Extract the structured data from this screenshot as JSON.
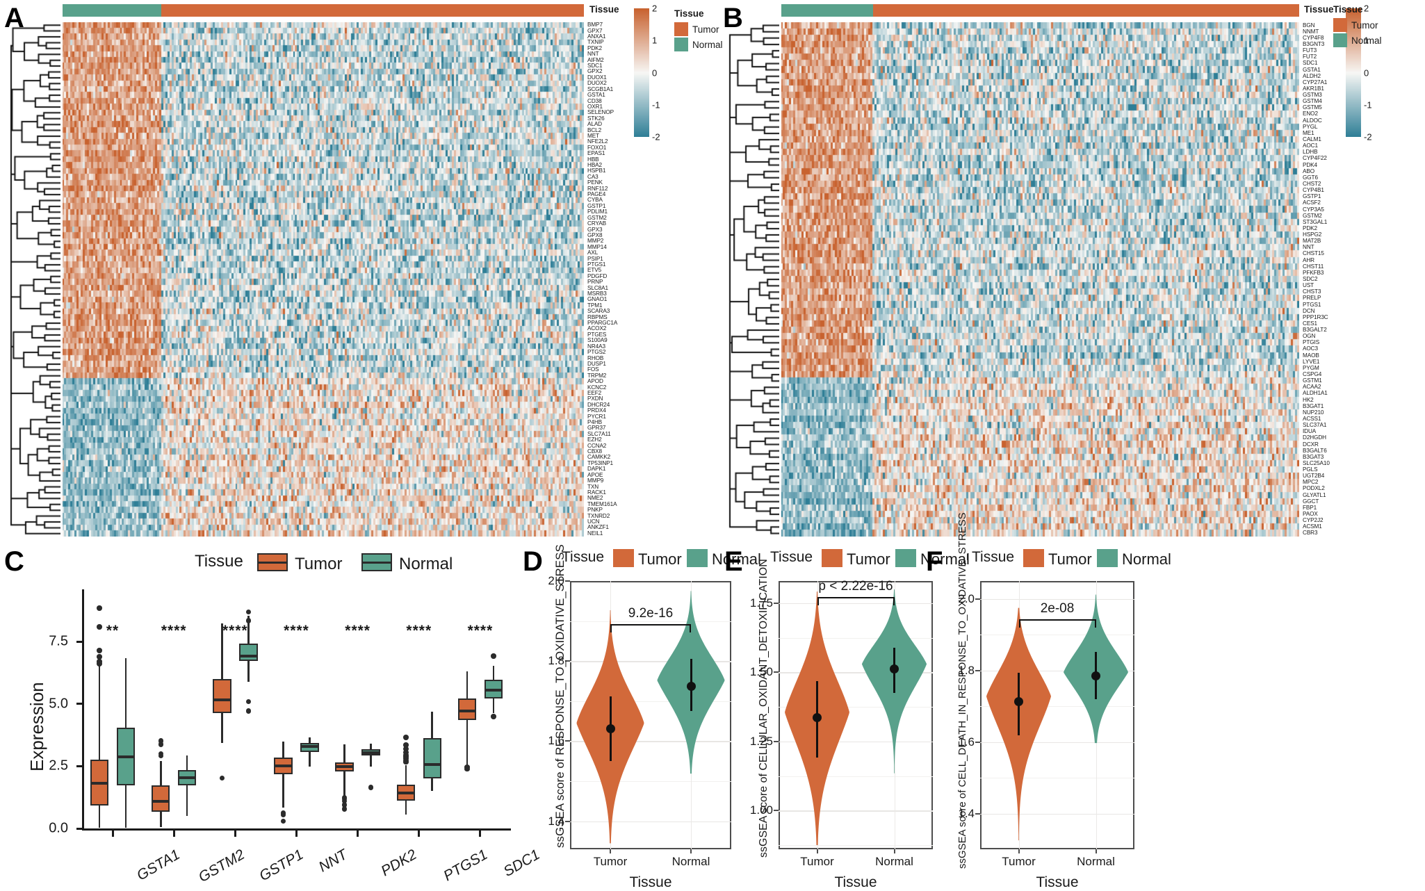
{
  "figure": {
    "panels": [
      "A",
      "B",
      "C",
      "D",
      "E",
      "F"
    ],
    "colors": {
      "tumor": "#d2693a",
      "normal": "#59a18b",
      "heat_high": "#c8622f",
      "heat_mid": "#f7f7f5",
      "heat_low": "#2e7e96",
      "outline": "#2b2b2b"
    }
  },
  "panelA": {
    "letter": "A",
    "annotation_title": "Tissue",
    "colorbar": {
      "ticks": [
        "2",
        "1",
        "0",
        "-1",
        "-2"
      ],
      "max": 2,
      "min": -2
    },
    "legend": {
      "title": "Tissue",
      "items": [
        {
          "label": "Tumor",
          "color": "#d2693a"
        },
        {
          "label": "Normal",
          "color": "#59a18b"
        }
      ]
    },
    "genes": [
      "BMP7",
      "GPX7",
      "ANXA1",
      "TXNIP",
      "PDK2",
      "NNT",
      "AIFM2",
      "SDC1",
      "GPX2",
      "DUOX1",
      "DUOX2",
      "SCGB1A1",
      "GSTA1",
      "CD38",
      "OXR1",
      "SELENOP",
      "STK26",
      "ALAD",
      "BCL2",
      "MET",
      "NFE2L2",
      "FOXO1",
      "EPAS1",
      "HBB",
      "HBA2",
      "HSPB1",
      "CA3",
      "PENK",
      "RNF112",
      "PAGE4",
      "CYBA",
      "GSTP1",
      "PDLIM1",
      "GSTM2",
      "CRYAB",
      "GPX3",
      "GPX8",
      "MMP2",
      "MMP14",
      "AXL",
      "PSIP1",
      "PTGS1",
      "ETV5",
      "PDGFD",
      "PRNP",
      "SLC8A1",
      "MSRB3",
      "GNAO1",
      "TPM1",
      "SCARA3",
      "RBPMS",
      "PPARGC1A",
      "ACOX2",
      "PTGES",
      "S100A9",
      "NR4A3",
      "PTGS2",
      "RHOB",
      "DUSP1",
      "FOS",
      "TRPM2",
      "APOD",
      "KCNC2",
      "EEF2",
      "PXDN",
      "DHCR24",
      "PRDX4",
      "PYCR1",
      "P4HB",
      "GPR37",
      "SLC7A11",
      "EZH2",
      "CCNA2",
      "CBX8",
      "CAMKK2",
      "TP53INP1",
      "DAPK1",
      "APOE",
      "MMP9",
      "TXN",
      "RACK1",
      "NME2",
      "TMEM161A",
      "PNKP",
      "TXNRD2",
      "UCN",
      "ANKZF1",
      "NEIL1"
    ]
  },
  "panelB": {
    "letter": "B",
    "annotation_title": "Tissue",
    "colorbar": {
      "ticks": [
        "2",
        "1",
        "0",
        "-1",
        "-2"
      ],
      "max": 2,
      "min": -2
    },
    "legend": {
      "title": "Tissue",
      "items": [
        {
          "label": "Tumor",
          "color": "#d2693a"
        },
        {
          "label": "Normal",
          "color": "#59a18b"
        }
      ]
    },
    "genes": [
      "BGN",
      "NNMT",
      "CYP4F8",
      "B3GNT3",
      "FUT3",
      "FUT2",
      "SDC1",
      "GSTA1",
      "ALDH2",
      "CYP27A1",
      "AKR1B1",
      "GSTM3",
      "GSTM4",
      "GSTM5",
      "ENO2",
      "ALDOC",
      "PYGL",
      "ME1",
      "CALM1",
      "AOC1",
      "LDHB",
      "CYP4F22",
      "PDK4",
      "ABO",
      "GGT6",
      "CHST2",
      "CYP4B1",
      "GSTP1",
      "ACSF2",
      "CYP3A5",
      "GSTM2",
      "ST3GAL1",
      "PDK2",
      "HSPG2",
      "MAT2B",
      "NNT",
      "CHST15",
      "AHR",
      "CHST11",
      "PFKFB3",
      "SDC2",
      "UST",
      "CHST3",
      "PRELP",
      "PTGS1",
      "DCN",
      "PPP1R3C",
      "CES1",
      "B3GALT2",
      "OGN",
      "PTGIS",
      "AOC3",
      "MAOB",
      "LYVE1",
      "PYGM",
      "CSPG4",
      "GSTM1",
      "ACAA2",
      "ALDH1A1",
      "HK2",
      "B3GAT1",
      "NUP210",
      "ACSS1",
      "SLC37A1",
      "IDUA",
      "D2HGDH",
      "DCXR",
      "B3GALT6",
      "B3GAT3",
      "SLC25A10",
      "PGLS",
      "UGT2B4",
      "MPC2",
      "PODXL2",
      "GLYATL1",
      "GGCT",
      "FBP1",
      "PAOX",
      "CYP2J2",
      "ACSM1",
      "CBR3"
    ]
  },
  "panelC": {
    "letter": "C",
    "legend": {
      "title": "Tissue",
      "items": [
        {
          "label": "Tumor",
          "color": "#d2693a"
        },
        {
          "label": "Normal",
          "color": "#59a18b"
        }
      ]
    },
    "chart_data": {
      "type": "box",
      "title": "",
      "xlabel": "",
      "ylabel": "Expression",
      "ylim": [
        0.0,
        9.6
      ],
      "yticks": [
        "0.0",
        "2.5",
        "5.0",
        "7.5"
      ],
      "ytickvals": [
        0.0,
        2.5,
        5.0,
        7.5
      ],
      "categories": [
        "GSTA1",
        "GSTM2",
        "GSTP1",
        "NNT",
        "PDK2",
        "PTGS1",
        "SDC1"
      ],
      "significance": [
        "**",
        "****",
        "****",
        "****",
        "****",
        "****",
        "****"
      ],
      "legend_position": "top",
      "series": [
        {
          "name": "Tumor",
          "color": "#d2693a",
          "boxes": [
            {
              "category": "GSTA1",
              "min": 0.02,
              "q1": 0.93,
              "median": 1.82,
              "q3": 2.77,
              "max": 6.55,
              "outliers": [
                8.85,
                8.1,
                7.15,
                6.9,
                6.7,
                6.62
              ]
            },
            {
              "category": "GSTM2",
              "min": 0.05,
              "q1": 0.68,
              "median": 1.1,
              "q3": 1.72,
              "max": 2.72,
              "outliers": [
                3.52,
                3.38,
                3.0,
                2.92
              ]
            },
            {
              "category": "GSTP1",
              "min": 3.42,
              "q1": 4.62,
              "median": 5.16,
              "q3": 6.0,
              "max": 8.22,
              "outliers": [
                2.02
              ]
            },
            {
              "category": "NNT",
              "min": 0.85,
              "q1": 2.18,
              "median": 2.52,
              "q3": 2.84,
              "max": 3.5,
              "outliers": [
                0.62,
                0.55,
                0.3
              ]
            },
            {
              "category": "PDK2",
              "min": 1.28,
              "q1": 2.3,
              "median": 2.48,
              "q3": 2.66,
              "max": 3.38,
              "outliers": [
                1.24,
                1.18,
                1.1,
                0.95,
                0.78
              ]
            },
            {
              "category": "PTGS1",
              "min": 0.55,
              "q1": 1.12,
              "median": 1.42,
              "q3": 1.75,
              "max": 2.55,
              "outliers": [
                3.65,
                3.35,
                3.2,
                3.05,
                2.95,
                2.88,
                2.8,
                2.72,
                2.66
              ]
            },
            {
              "category": "SDC1",
              "min": 2.48,
              "q1": 4.35,
              "median": 4.73,
              "q3": 5.22,
              "max": 6.3,
              "outliers": [
                2.45,
                2.38
              ]
            }
          ]
        },
        {
          "name": "Normal",
          "color": "#59a18b",
          "boxes": [
            {
              "category": "GSTA1",
              "min": 0.02,
              "q1": 1.73,
              "median": 2.88,
              "q3": 4.05,
              "max": 6.85,
              "outliers": []
            },
            {
              "category": "GSTM2",
              "min": 0.5,
              "q1": 1.72,
              "median": 2.05,
              "q3": 2.35,
              "max": 2.92,
              "outliers": []
            },
            {
              "category": "GSTP1",
              "min": 5.9,
              "q1": 6.72,
              "median": 6.92,
              "q3": 7.42,
              "max": 8.55,
              "outliers": [
                8.7,
                8.35,
                5.1,
                4.72
              ]
            },
            {
              "category": "NNT",
              "min": 2.48,
              "q1": 3.08,
              "median": 3.28,
              "q3": 3.42,
              "max": 3.65,
              "outliers": []
            },
            {
              "category": "PDK2",
              "min": 2.48,
              "q1": 2.92,
              "median": 3.04,
              "q3": 3.18,
              "max": 3.4,
              "outliers": [
                1.65
              ]
            },
            {
              "category": "PTGS1",
              "min": 1.5,
              "q1": 2.02,
              "median": 2.58,
              "q3": 3.62,
              "max": 4.68,
              "outliers": []
            },
            {
              "category": "SDC1",
              "min": 4.62,
              "q1": 5.22,
              "median": 5.56,
              "q3": 5.98,
              "max": 6.52,
              "outliers": [
                6.92,
                4.5
              ]
            }
          ]
        }
      ]
    }
  },
  "panelD": {
    "letter": "D",
    "legend": {
      "title": "Tissue",
      "items": [
        {
          "label": "Tumor",
          "color": "#d2693a"
        },
        {
          "label": "Normal",
          "color": "#59a18b"
        }
      ]
    },
    "chart_data": {
      "type": "violin",
      "ylabel": "ssGSEA score of RESPONSE_TO_OXIDATIVE_STRESS",
      "xlabel": "Tissue",
      "ylim": [
        1.33,
        2.0
      ],
      "yticks": [
        "1.4",
        "1.6",
        "1.8",
        "2.0"
      ],
      "ytickvals": [
        1.4,
        1.6,
        1.8,
        2.0
      ],
      "categories": [
        "Tumor",
        "Normal"
      ],
      "annotation": "9.2e-16",
      "groups": [
        {
          "name": "Tumor",
          "color": "#d2693a",
          "mean": 1.631,
          "ci_low": 1.551,
          "ci_high": 1.712,
          "min": 1.345,
          "max": 1.927,
          "mode": 1.645
        },
        {
          "name": "Normal",
          "color": "#59a18b",
          "mean": 1.737,
          "ci_low": 1.675,
          "ci_high": 1.805,
          "min": 1.519,
          "max": 1.975,
          "mode": 1.752
        }
      ]
    }
  },
  "panelE": {
    "letter": "E",
    "legend": {
      "title": "Tissue",
      "items": [
        {
          "label": "Tumor",
          "color": "#d2693a"
        },
        {
          "label": "Normal",
          "color": "#59a18b"
        }
      ]
    },
    "chart_data": {
      "type": "violin",
      "ylabel": "ssGSEA score of CELLULAR_OXIDANT_DETOXIFICATION",
      "xlabel": "Tissue",
      "ylim": [
        0.86,
        1.83
      ],
      "yticks": [
        "1.00",
        "1.25",
        "1.50",
        "1.75"
      ],
      "ytickvals": [
        1.0,
        1.25,
        1.5,
        1.75
      ],
      "categories": [
        "Tumor",
        "Normal"
      ],
      "annotation": "p < 2.22e-16",
      "groups": [
        {
          "name": "Tumor",
          "color": "#d2693a",
          "mean": 1.335,
          "ci_low": 1.192,
          "ci_high": 1.468,
          "min": 0.875,
          "max": 1.792,
          "mode": 1.355
        },
        {
          "name": "Normal",
          "color": "#59a18b",
          "mean": 1.512,
          "ci_low": 1.425,
          "ci_high": 1.588,
          "min": 1.135,
          "max": 1.8,
          "mode": 1.53
        }
      ]
    }
  },
  "panelF": {
    "letter": "F",
    "legend": {
      "title": "Tissue",
      "items": [
        {
          "label": "Tumor",
          "color": "#d2693a"
        },
        {
          "label": "Normal",
          "color": "#59a18b"
        }
      ]
    },
    "chart_data": {
      "type": "violin",
      "ylabel": "ssGSEA score of CELL_DEATH_IN_RESPONSE_TO_OXIDATIVE_STRESS",
      "xlabel": "Tissue",
      "ylim": [
        1.3,
        2.05
      ],
      "yticks": [
        "1.4",
        "1.6",
        "1.8",
        "2.0"
      ],
      "ytickvals": [
        1.4,
        1.6,
        1.8,
        2.0
      ],
      "categories": [
        "Tumor",
        "Normal"
      ],
      "annotation": "2e-08",
      "groups": [
        {
          "name": "Tumor",
          "color": "#d2693a",
          "mean": 1.712,
          "ci_low": 1.618,
          "ci_high": 1.793,
          "min": 1.325,
          "max": 1.975,
          "mode": 1.728
        },
        {
          "name": "Normal",
          "color": "#59a18b",
          "mean": 1.785,
          "ci_low": 1.72,
          "ci_high": 1.852,
          "min": 1.597,
          "max": 2.012,
          "mode": 1.795
        }
      ]
    }
  }
}
